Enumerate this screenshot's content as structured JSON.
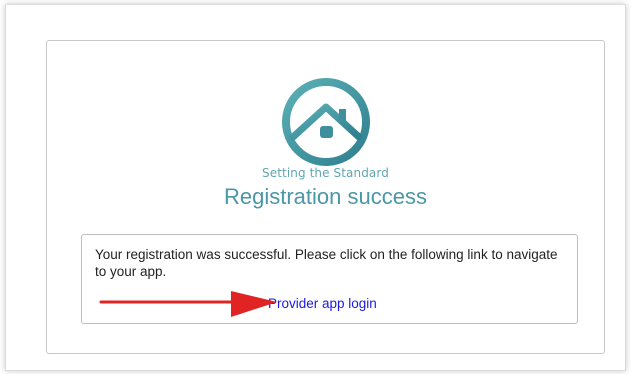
{
  "logo": {
    "icon": "house-in-circle-icon",
    "tagline": "Setting the Standard",
    "color": "#4a97a6"
  },
  "page": {
    "heading": "Registration success"
  },
  "message": {
    "text": "Your registration was successful. Please click on the following link to navigate to your app.",
    "link_label": "Provider app login",
    "link_color": "#1a1ae6"
  },
  "annotation": {
    "icon": "red-arrow-icon",
    "color": "#e02424"
  }
}
